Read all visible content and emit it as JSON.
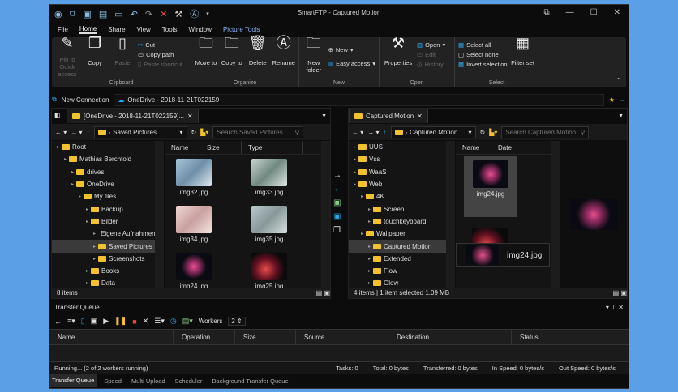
{
  "window": {
    "title": "SmartFTP - Captured Motion"
  },
  "menu": [
    "File",
    "Home",
    "Share",
    "View",
    "Tools",
    "Window",
    "Picture Tools"
  ],
  "ribbon": {
    "clipboard": {
      "label": "Clipboard",
      "pin": "Pin to Quick access",
      "copy": "Copy",
      "paste": "Paste",
      "cut": "Cut",
      "copy_path": "Copy path",
      "paste_shortcut": "Paste shortcut"
    },
    "organize": {
      "label": "Organize",
      "move": "Move to",
      "copy": "Copy to",
      "delete": "Delete",
      "rename": "Rename"
    },
    "new": {
      "label": "New",
      "folder": "New folder",
      "new_item": "New",
      "easy": "Easy access"
    },
    "open": {
      "label": "Open",
      "properties": "Properties",
      "open": "Open",
      "edit": "Edit",
      "history": "History"
    },
    "select": {
      "label": "Select",
      "all": "Select all",
      "none": "Select none",
      "invert": "Invert selection",
      "filter": "Filter set"
    }
  },
  "connection": {
    "label": "New Connection",
    "address": "OneDrive - 2018-11-21T022159"
  },
  "left": {
    "tab": "[OneDrive - 2018-11-21T022159]...",
    "path": "Saved Pictures",
    "search": "Search Saved Pictures",
    "tree": [
      {
        "t": "Root",
        "l": 0
      },
      {
        "t": "Mathias Berchtold",
        "l": 1
      },
      {
        "t": "drives",
        "l": 2
      },
      {
        "t": "OneDrive",
        "l": 2
      },
      {
        "t": "My files",
        "l": 3
      },
      {
        "t": "Backup",
        "l": 4
      },
      {
        "t": "Bilder",
        "l": 4
      },
      {
        "t": "Eigene Aufnahmen",
        "l": 5
      },
      {
        "t": "Saved Pictures",
        "l": 5,
        "sel": true
      },
      {
        "t": "Screenshots",
        "l": 5
      },
      {
        "t": "Books",
        "l": 4
      },
      {
        "t": "Data",
        "l": 4
      }
    ],
    "columns": [
      "Name",
      "Size",
      "Type"
    ],
    "files": [
      "img32.jpg",
      "img33.jpg",
      "img34.jpg",
      "img35.jpg",
      "img24.jpg",
      "img25.jpg"
    ],
    "status": "8 items"
  },
  "right": {
    "tab": "Captured Motion",
    "path": "Captured Motion",
    "search": "Search Captured Motion",
    "tree": [
      {
        "t": "UUS",
        "l": 0
      },
      {
        "t": "Vss",
        "l": 0
      },
      {
        "t": "WaaS",
        "l": 0
      },
      {
        "t": "Web",
        "l": 0
      },
      {
        "t": "4K",
        "l": 1
      },
      {
        "t": "Screen",
        "l": 2
      },
      {
        "t": "touchkeyboard",
        "l": 2
      },
      {
        "t": "Wallpaper",
        "l": 1
      },
      {
        "t": "Captured Motion",
        "l": 2,
        "sel": true
      },
      {
        "t": "Extended",
        "l": 2
      },
      {
        "t": "Flow",
        "l": 2
      },
      {
        "t": "Glow",
        "l": 2
      }
    ],
    "columns": [
      "Name",
      "Date"
    ],
    "files": [
      "img24.jpg",
      ""
    ],
    "tooltip": "img24.jpg",
    "status": "4 items  |  1 item selected  1.09 MB"
  },
  "queue": {
    "title": "Transfer Queue",
    "workers_label": "Workers",
    "workers": "2",
    "columns": [
      "Name",
      "Operation",
      "Size",
      "Source",
      "Destination",
      "Status"
    ],
    "status": "Running... (2 of 2 workers running)",
    "tasks": "Tasks: 0",
    "total": "Total: 0 bytes",
    "transferred": "Transferred: 0 bytes",
    "in_speed": "In Speed: 0 bytes/s",
    "out_speed": "Out Speed: 0 bytes/s",
    "tabs": [
      "Transfer Queue",
      "Speed",
      "Multi Upload",
      "Scheduler",
      "Background Transfer Queue"
    ]
  }
}
